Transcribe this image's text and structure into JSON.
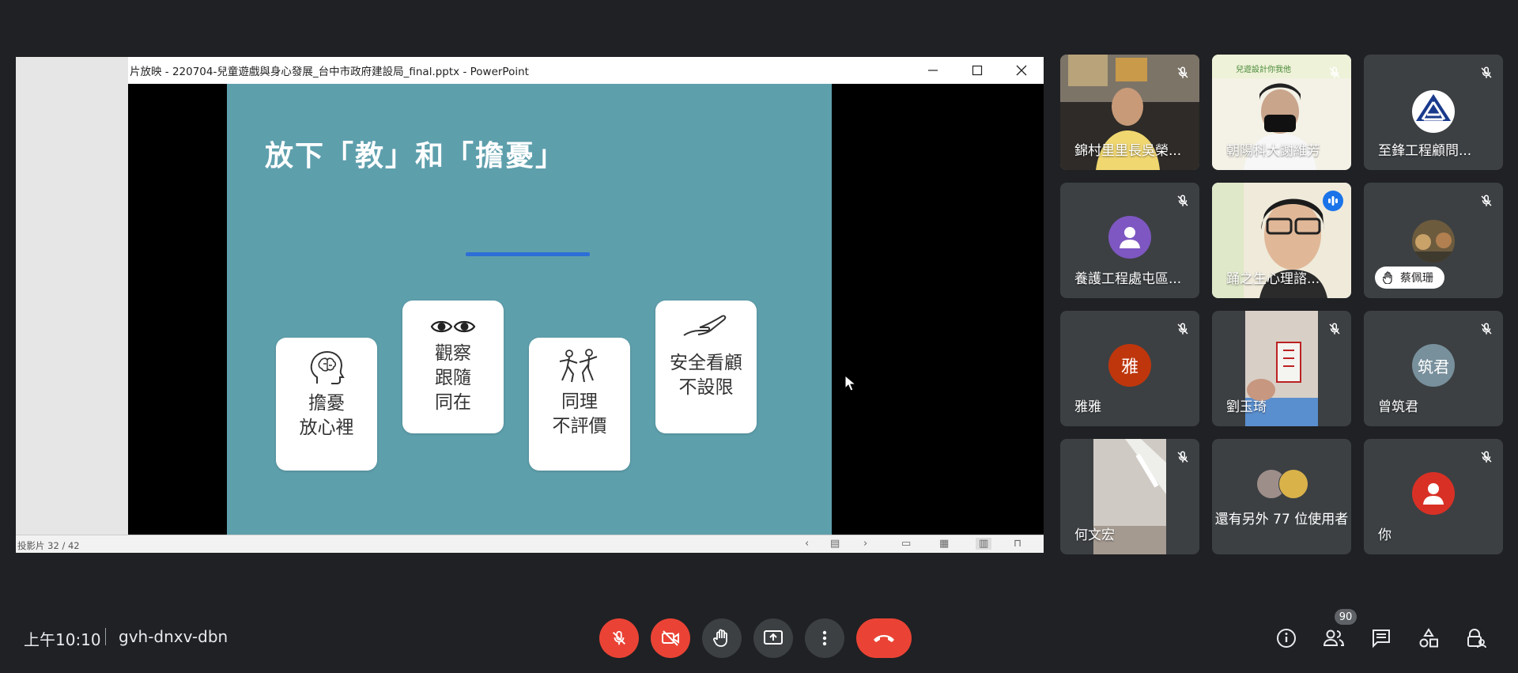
{
  "ppt": {
    "window_title": "片放映  -  220704-兒童遊戲與身心發展_台中市政府建設局_final.pptx - PowerPoint",
    "slide_counter": "投影片 32 / 42"
  },
  "slide": {
    "title": "放下「教」和「擔憂」",
    "cards": [
      {
        "text": "擔憂\n放心裡",
        "icon": "head-brain-icon"
      },
      {
        "text": "觀察\n跟隨\n同在",
        "icon": "eyes-icon"
      },
      {
        "text": "同理\n不評價",
        "icon": "dancing-people-icon"
      },
      {
        "text": "安全看顧\n不設限",
        "icon": "open-hand-icon"
      }
    ],
    "background_color": "#5e9fac",
    "line_color": "#2d6fd6"
  },
  "participants": [
    {
      "name": "錦村里里長吳榮...",
      "type": "video",
      "muted": true
    },
    {
      "name": "朝陽科大謝維芳",
      "type": "video",
      "muted": true
    },
    {
      "name": "至鋒工程顧問...",
      "type": "logo",
      "muted": true
    },
    {
      "name": "養護工程處屯區...",
      "type": "avatar",
      "avatar_color": "#7e57c2",
      "muted": true
    },
    {
      "name": "踊之生心理諮...",
      "type": "video",
      "speaking": true
    },
    {
      "name": "蔡佩珊",
      "type": "hand-raised",
      "muted": true
    },
    {
      "name": "雅雅",
      "type": "avatar",
      "initial": "雅",
      "avatar_color": "#bf360c",
      "muted": true
    },
    {
      "name": "劉玉琦",
      "type": "video",
      "muted": true
    },
    {
      "name": "曾筑君",
      "type": "avatar",
      "initial": "筑君",
      "avatar_color": "#78909c",
      "muted": true
    },
    {
      "name": "何文宏",
      "type": "video",
      "muted": true
    },
    {
      "name": "還有另外 77 位使用者",
      "type": "others"
    },
    {
      "name": "你",
      "type": "avatar",
      "avatar_color": "#d93025",
      "muted": true
    }
  ],
  "bottom_bar": {
    "time": "上午10:10",
    "meeting_code": "gvh-dnxv-dbn",
    "participant_count": "90"
  }
}
